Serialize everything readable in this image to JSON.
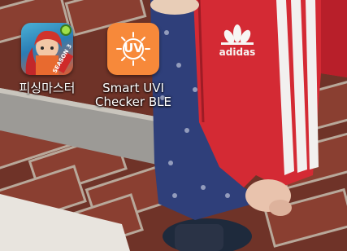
{
  "apps": [
    {
      "id": "fishing",
      "label": "피싱마스터",
      "badge": "SEASON 3",
      "icon": "fishing-game-icon"
    },
    {
      "id": "uv",
      "label_lines": [
        "Smart UVI",
        "Checker BLE"
      ],
      "icon_text": "UV",
      "icon": "sun-uv-icon",
      "color": "#f7893a"
    }
  ],
  "wallpaper": {
    "subject": "child-in-red-jacket-on-brick-pavement",
    "jacket_brand": "adidas"
  }
}
